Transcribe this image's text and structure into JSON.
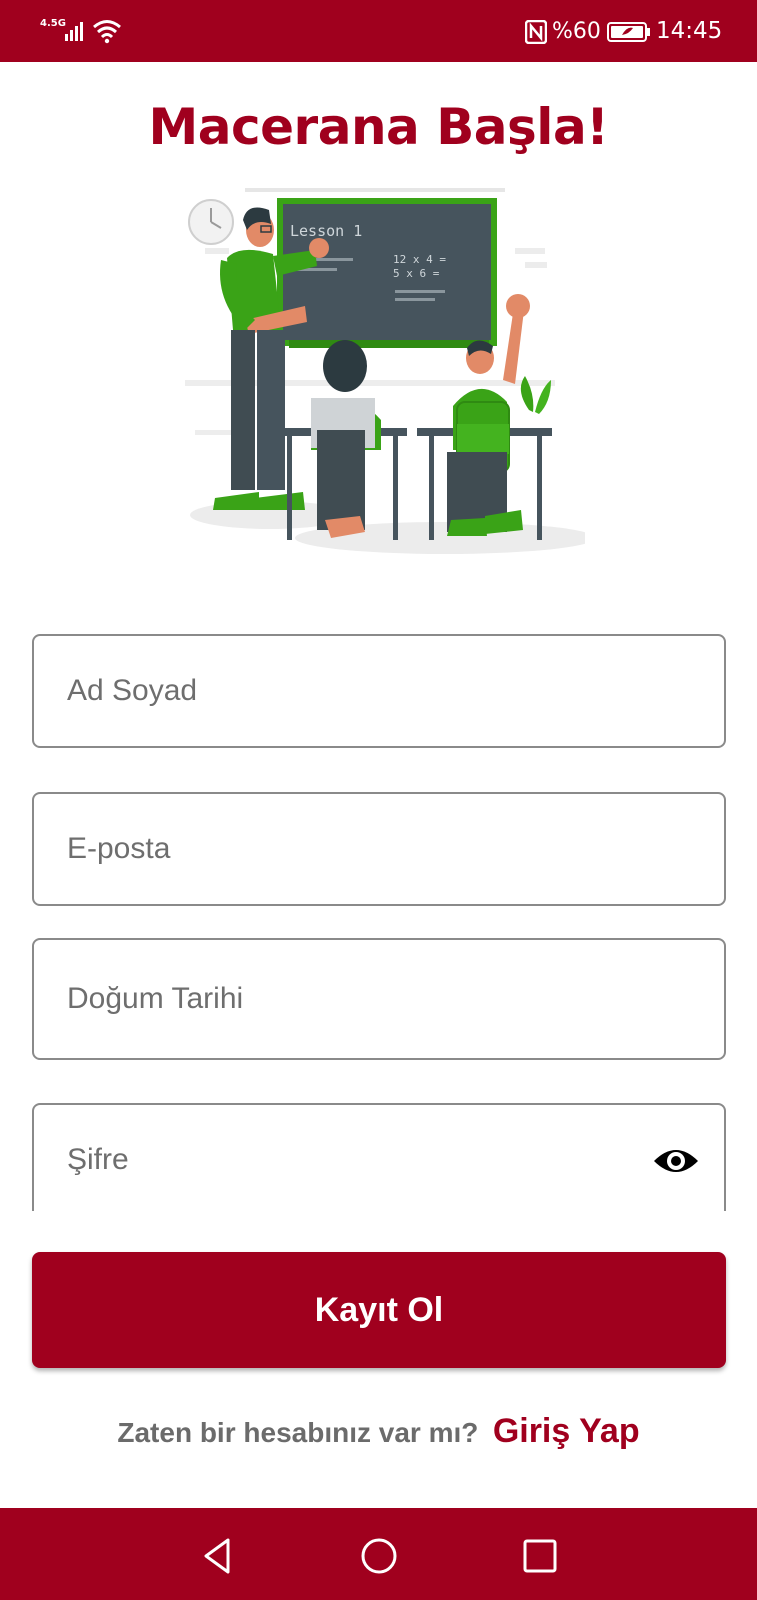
{
  "status_bar": {
    "network": "4.5G",
    "battery_percent": "%60",
    "time": "14:45",
    "icons": [
      "signal-icon",
      "wifi-icon",
      "nfc-icon",
      "battery-icon"
    ]
  },
  "title": "Macerana Başla!",
  "illustration": {
    "board_text": "Lesson 1",
    "board_line1": "12 x 4 =",
    "board_line2": "5 x 6 ="
  },
  "form": {
    "name_placeholder": "Ad Soyad",
    "email_placeholder": "E-posta",
    "birth_placeholder": "Doğum Tarihi",
    "password_placeholder": "Şifre"
  },
  "register_button": "Kayıt Ol",
  "login_prompt": {
    "question": "Zaten bir hesabınız var mı?",
    "link": "Giriş Yap"
  },
  "colors": {
    "accent": "#a0001e",
    "illustration_green": "#3aa317",
    "board": "#46545d"
  },
  "nav_bar": {
    "icons": [
      "back-icon",
      "home-icon",
      "recent-apps-icon"
    ]
  }
}
